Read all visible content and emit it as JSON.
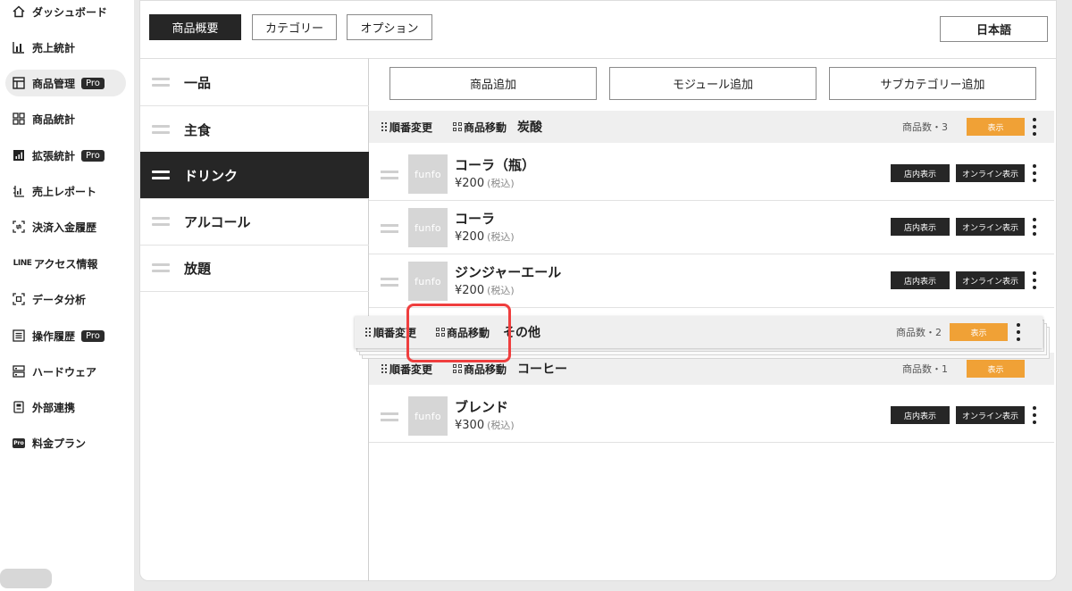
{
  "sidebar": {
    "items": [
      {
        "label": "ダッシュボード",
        "icon": "home-icon"
      },
      {
        "label": "売上統計",
        "icon": "bar-chart-icon"
      },
      {
        "label": "商品管理",
        "icon": "layout-icon",
        "badge": "Pro",
        "active": true
      },
      {
        "label": "商品統計",
        "icon": "grid-icon"
      },
      {
        "label": "拡張統計",
        "icon": "stats-icon",
        "badge": "Pro"
      },
      {
        "label": "売上レポート",
        "icon": "report-icon"
      },
      {
        "label": "決済入金履歴",
        "icon": "payment-icon"
      },
      {
        "label": "アクセス情報",
        "icon": "line-logo",
        "icon_text": "LINE"
      },
      {
        "label": "データ分析",
        "icon": "scan-icon"
      },
      {
        "label": "操作履歴",
        "icon": "list-icon",
        "badge": "Pro"
      },
      {
        "label": "ハードウェア",
        "icon": "hardware-icon"
      },
      {
        "label": "外部連携",
        "icon": "document-icon"
      },
      {
        "label": "料金プラン",
        "icon": "pro-icon",
        "icon_text": "Pro"
      }
    ]
  },
  "tabs": [
    "商品概要",
    "カテゴリー",
    "オプション"
  ],
  "language_button": "日本語",
  "categories": [
    {
      "label": "一品"
    },
    {
      "label": "主食"
    },
    {
      "label": "ドリンク",
      "active": true
    },
    {
      "label": "アルコール"
    },
    {
      "label": "放題"
    }
  ],
  "actions": {
    "add_product": "商品追加",
    "add_module": "モジュール追加",
    "add_subcategory": "サブカテゴリー追加"
  },
  "header_labels": {
    "reorder": "順番変更",
    "move": "商品移動",
    "show": "表示"
  },
  "subcategories": [
    {
      "title": "炭酸",
      "count_label": "商品数・3",
      "products": [
        {
          "name": "コーラ（瓶）",
          "price": "¥200",
          "tax": "(税込)"
        },
        {
          "name": "コーラ",
          "price": "¥200",
          "tax": "(税込)"
        },
        {
          "name": "ジンジャーエール",
          "price": "¥200",
          "tax": "(税込)"
        }
      ]
    },
    {
      "title": "コーヒー",
      "count_label": "商品数・1",
      "products": [
        {
          "name": "ブレンド",
          "price": "¥300",
          "tax": "(税込)"
        }
      ]
    }
  ],
  "dragging": {
    "title": "その他",
    "count_label": "商品数・2"
  },
  "product_buttons": {
    "store": "店内表示",
    "online": "オンライン表示"
  },
  "thumbnail_text": "funfo",
  "colors": {
    "accent": "#f0a136",
    "dark": "#262626",
    "highlight": "#ef3e3e"
  }
}
